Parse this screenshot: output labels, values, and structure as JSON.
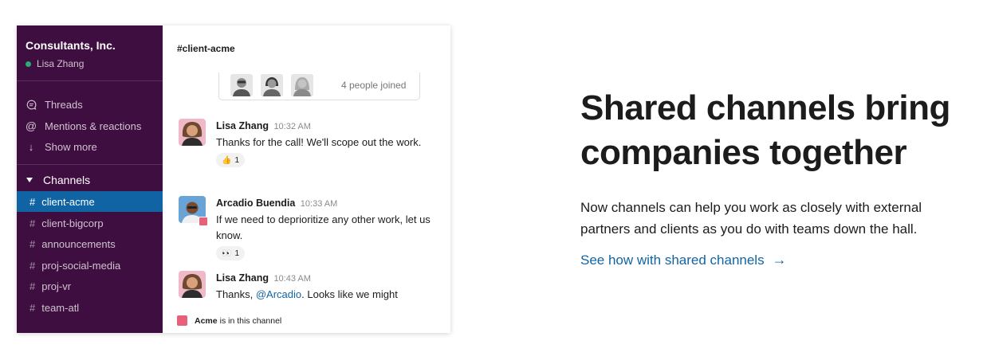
{
  "sidebar": {
    "workspace_name": "Consultants, Inc.",
    "user_name": "Lisa Zhang",
    "nav": [
      {
        "label": "Threads",
        "icon": "threads-icon"
      },
      {
        "label": "Mentions & reactions",
        "icon": "at-icon"
      },
      {
        "label": "Show more",
        "icon": "arrow-down-icon"
      }
    ],
    "channels_header": "Channels",
    "channels": [
      "client-acme",
      "client-bigcorp",
      "announcements",
      "proj-social-media",
      "proj-vr",
      "team-atl"
    ],
    "active_channel": "client-acme"
  },
  "main": {
    "channel_title": "#client-acme",
    "joined_text": "4 people joined",
    "messages": [
      {
        "author": "Lisa Zhang",
        "time": "10:32 AM",
        "text": "Thanks for the call! We'll scope out the work.",
        "reaction": {
          "emoji": "👍",
          "count": "1"
        }
      },
      {
        "author": "Arcadio Buendia",
        "time": "10:33 AM",
        "text": "If we need to deprioritize any other work, let us know.",
        "reaction": {
          "emoji": "👀",
          "count": "1"
        }
      },
      {
        "author": "Lisa Zhang",
        "time": "10:43 AM",
        "text_before": "Thanks, ",
        "mention": "@Arcadio",
        "text_after": ". Looks like we might"
      }
    ],
    "footer": {
      "org": "Acme",
      "text": "is in this channel"
    }
  },
  "marketing": {
    "headline": "Shared channels bring companies together",
    "body": "Now channels can help you work as closely with external partners and clients as you do with teams down the hall.",
    "cta": "See how with shared channels",
    "cta_arrow": "→"
  },
  "colors": {
    "sidebar": "#3f0e40",
    "active_channel": "#1164a3",
    "link": "#1264a3",
    "external_badge": "#e8607a"
  }
}
